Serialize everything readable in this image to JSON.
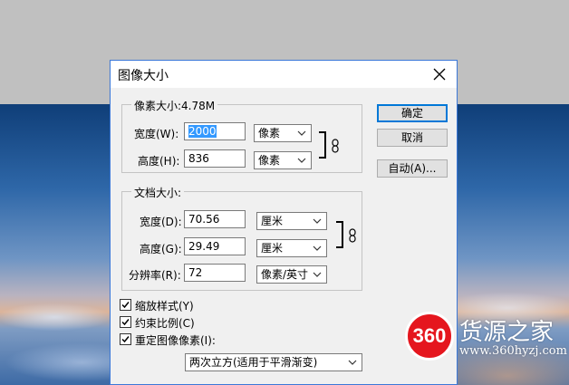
{
  "dialog": {
    "title": "图像大小",
    "ok_label": "确定",
    "cancel_label": "取消",
    "auto_label": "自动(A)..."
  },
  "pixel_dimensions": {
    "legend": "像素大小:4.78M",
    "width_label": "宽度(W):",
    "width_value": "2000",
    "width_unit": "像素",
    "height_label": "高度(H):",
    "height_value": "836",
    "height_unit": "像素"
  },
  "document_size": {
    "legend": "文档大小:",
    "width_label": "宽度(D):",
    "width_value": "70.56",
    "width_unit": "厘米",
    "height_label": "高度(G):",
    "height_value": "29.49",
    "height_unit": "厘米",
    "resolution_label": "分辨率(R):",
    "resolution_value": "72",
    "resolution_unit": "像素/英寸"
  },
  "options": {
    "scale_styles": {
      "label": "缩放样式(Y)",
      "checked": true
    },
    "constrain_proportions": {
      "label": "约束比例(C)",
      "checked": true
    },
    "resample_image": {
      "label": "重定图像像素(I):",
      "checked": true
    },
    "resample_method": "两次立方(适用于平滑渐变)"
  },
  "watermark": {
    "logo_text": "360",
    "name": "货源之家",
    "url": "www.360hyzj.com"
  },
  "colors": {
    "accent": "#0078d7",
    "selection": "#3399ff",
    "logo_red": "#e5161e"
  }
}
